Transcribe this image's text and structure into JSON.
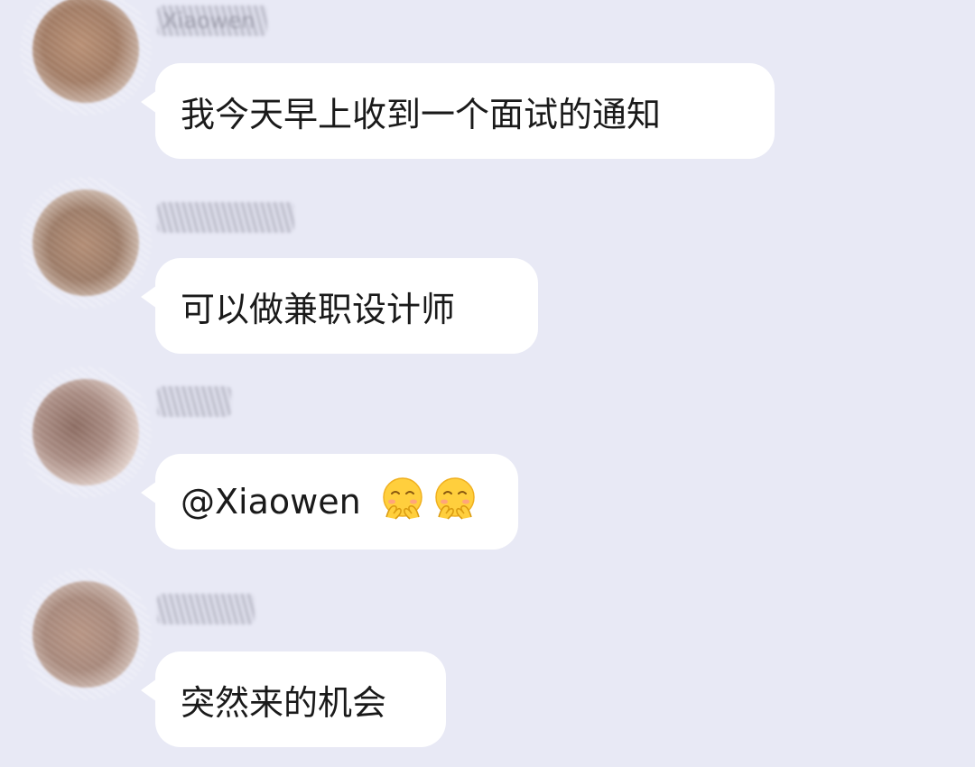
{
  "chat": {
    "messages": [
      {
        "sender_name": "Xiaowen",
        "text": "我今天早上收到一个面试的通知",
        "emoji_count": 0
      },
      {
        "sender_name": "",
        "text": "可以做兼职设计师",
        "emoji_count": 0
      },
      {
        "sender_name": "",
        "text": "@Xiaowen",
        "emoji_count": 2,
        "emoji": "shy-face-emoji"
      },
      {
        "sender_name": "",
        "text": "突然来的机会",
        "emoji_count": 0
      }
    ]
  },
  "colors": {
    "background": "#e8e9f5",
    "bubble": "#ffffff",
    "text": "#1a1a1a",
    "emoji_yellow": "#ffcf3d"
  },
  "icons": {
    "avatar": "blurred-avatar",
    "emoji": "shy-face-emoji"
  }
}
